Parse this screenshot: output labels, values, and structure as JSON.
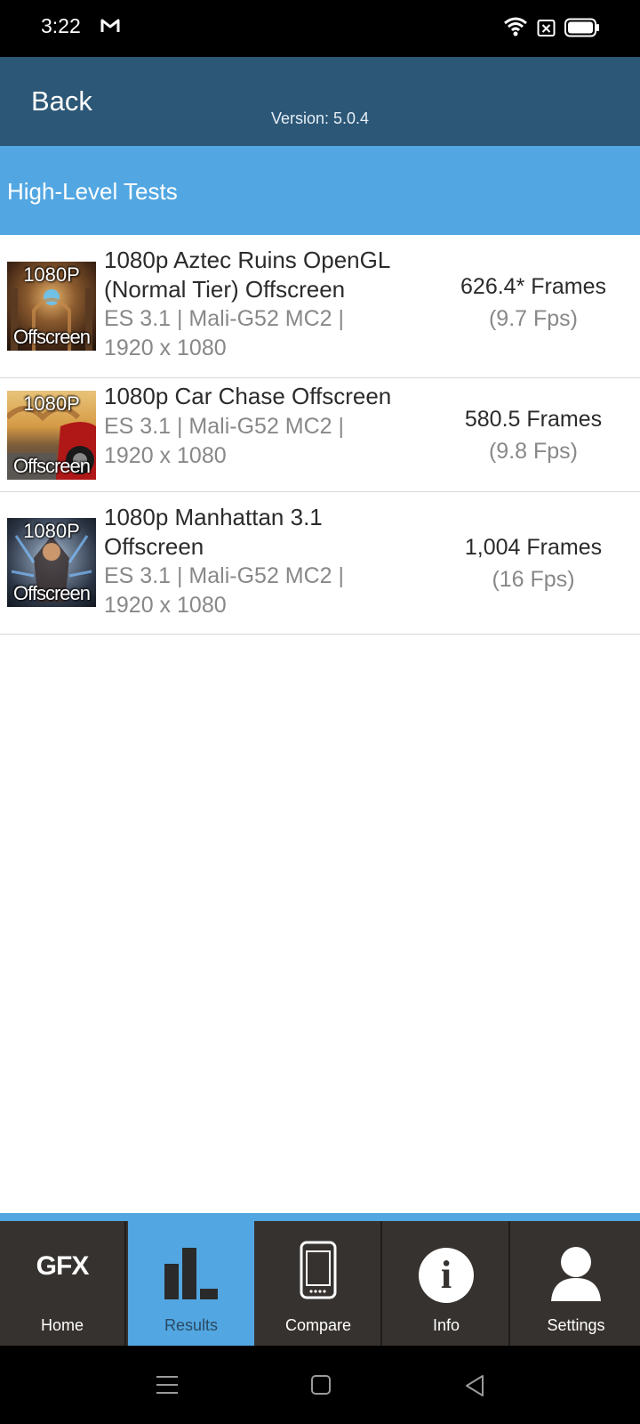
{
  "status_bar": {
    "time": "3:22"
  },
  "header": {
    "back_label": "Back",
    "version": "Version: 5.0.4"
  },
  "section": {
    "title": "High-Level Tests"
  },
  "results": [
    {
      "thumb_top": "1080P",
      "thumb_bottom": "Offscreen",
      "name_line1": "1080p Aztec Ruins OpenGL",
      "name_line2": "(Normal Tier) Offscreen",
      "api_gpu": "ES 3.1 | Mali-G52 MC2 |",
      "resolution": "1920 x 1080",
      "score": "626.4* Frames",
      "fps": "(9.7 Fps)"
    },
    {
      "thumb_top": "1080P",
      "thumb_bottom": "Offscreen",
      "name_line1": "1080p Car Chase Offscreen",
      "api_gpu": "ES 3.1 | Mali-G52 MC2 |",
      "resolution": "1920 x 1080",
      "score": "580.5 Frames",
      "fps": "(9.8 Fps)"
    },
    {
      "thumb_top": "1080P",
      "thumb_bottom": "Offscreen",
      "name_line1": "1080p Manhattan 3.1",
      "name_line2": "Offscreen",
      "api_gpu": "ES 3.1 | Mali-G52 MC2 |",
      "resolution": "1920 x 1080",
      "score": "1,004 Frames",
      "fps": "(16 Fps)"
    }
  ],
  "tabs": {
    "home": {
      "icon_text": "GFX",
      "label": "Home"
    },
    "results": {
      "label": "Results"
    },
    "compare": {
      "label": "Compare"
    },
    "info": {
      "icon_text": "i",
      "label": "Info"
    },
    "settings": {
      "label": "Settings"
    }
  },
  "colors": {
    "header_bg": "#2c5777",
    "accent_blue": "#52a7e2",
    "tabbar_bg": "#36322f"
  }
}
